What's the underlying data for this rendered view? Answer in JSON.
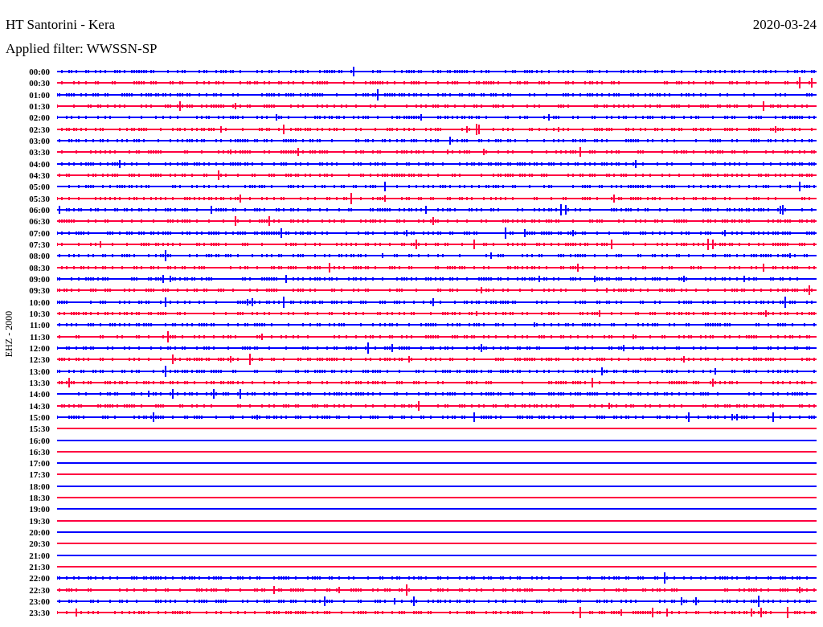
{
  "title": "HT Santorini - Kera",
  "date": "2020-03-24",
  "filter": "Applied filter: WWSSN-SP",
  "channel_label": "EHZ - 2000",
  "rows": [
    {
      "time": "00:00",
      "color": "#0000ff",
      "recorded": true
    },
    {
      "time": "00:30",
      "color": "#ff0040",
      "recorded": true
    },
    {
      "time": "01:00",
      "color": "#0000ff",
      "recorded": true
    },
    {
      "time": "01:30",
      "color": "#ff0040",
      "recorded": true
    },
    {
      "time": "02:00",
      "color": "#0000ff",
      "recorded": true
    },
    {
      "time": "02:30",
      "color": "#ff0040",
      "recorded": true
    },
    {
      "time": "03:00",
      "color": "#0000ff",
      "recorded": true
    },
    {
      "time": "03:30",
      "color": "#ff0040",
      "recorded": true
    },
    {
      "time": "04:00",
      "color": "#0000ff",
      "recorded": true
    },
    {
      "time": "04:30",
      "color": "#ff0040",
      "recorded": true
    },
    {
      "time": "05:00",
      "color": "#0000ff",
      "recorded": true
    },
    {
      "time": "05:30",
      "color": "#ff0040",
      "recorded": true
    },
    {
      "time": "06:00",
      "color": "#0000ff",
      "recorded": true
    },
    {
      "time": "06:30",
      "color": "#ff0040",
      "recorded": true
    },
    {
      "time": "07:00",
      "color": "#0000ff",
      "recorded": true
    },
    {
      "time": "07:30",
      "color": "#ff0040",
      "recorded": true
    },
    {
      "time": "08:00",
      "color": "#0000ff",
      "recorded": true
    },
    {
      "time": "08:30",
      "color": "#ff0040",
      "recorded": true
    },
    {
      "time": "09:00",
      "color": "#0000ff",
      "recorded": true
    },
    {
      "time": "09:30",
      "color": "#ff0040",
      "recorded": true
    },
    {
      "time": "10:00",
      "color": "#0000ff",
      "recorded": true
    },
    {
      "time": "10:30",
      "color": "#ff0040",
      "recorded": true
    },
    {
      "time": "11:00",
      "color": "#0000ff",
      "recorded": true
    },
    {
      "time": "11:30",
      "color": "#ff0040",
      "recorded": true
    },
    {
      "time": "12:00",
      "color": "#0000ff",
      "recorded": true
    },
    {
      "time": "12:30",
      "color": "#ff0040",
      "recorded": true
    },
    {
      "time": "13:00",
      "color": "#0000ff",
      "recorded": true
    },
    {
      "time": "13:30",
      "color": "#ff0040",
      "recorded": true
    },
    {
      "time": "14:00",
      "color": "#0000ff",
      "recorded": true
    },
    {
      "time": "14:30",
      "color": "#ff0040",
      "recorded": true
    },
    {
      "time": "15:00",
      "color": "#0000ff",
      "recorded": true
    },
    {
      "time": "15:30",
      "color": "#ff0040",
      "recorded": false
    },
    {
      "time": "16:00",
      "color": "#0000ff",
      "recorded": false
    },
    {
      "time": "16:30",
      "color": "#ff0040",
      "recorded": false
    },
    {
      "time": "17:00",
      "color": "#0000ff",
      "recorded": false
    },
    {
      "time": "17:30",
      "color": "#ff0040",
      "recorded": false
    },
    {
      "time": "18:00",
      "color": "#0000ff",
      "recorded": false
    },
    {
      "time": "18:30",
      "color": "#ff0040",
      "recorded": false
    },
    {
      "time": "19:00",
      "color": "#0000ff",
      "recorded": false
    },
    {
      "time": "19:30",
      "color": "#ff0040",
      "recorded": false
    },
    {
      "time": "20:00",
      "color": "#0000ff",
      "recorded": false
    },
    {
      "time": "20:30",
      "color": "#ff0040",
      "recorded": false
    },
    {
      "time": "21:00",
      "color": "#0000ff",
      "recorded": false
    },
    {
      "time": "21:30",
      "color": "#ff0040",
      "recorded": false
    },
    {
      "time": "22:00",
      "color": "#0000ff",
      "recorded": true
    },
    {
      "time": "22:30",
      "color": "#ff0040",
      "recorded": true
    },
    {
      "time": "23:00",
      "color": "#0000ff",
      "recorded": true
    },
    {
      "time": "23:30",
      "color": "#ff0040",
      "recorded": true
    }
  ]
}
